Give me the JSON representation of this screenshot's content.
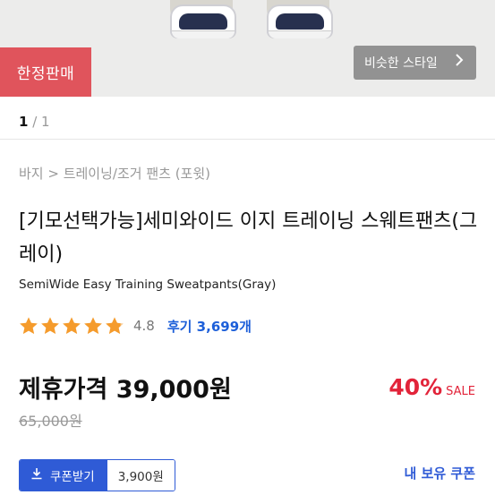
{
  "hero": {
    "limited_badge": "한정판매",
    "similar_style_label": "비슷한 스타일",
    "similar_chevron": "chevron-right-icon"
  },
  "pager": {
    "current": "1",
    "separator": " / ",
    "total": "1"
  },
  "breadcrumb": "바지 > 트레이닝/조거 팬츠 (포윗)",
  "product": {
    "title": "[기모선택가능]세미와이드 이지 트레이닝 스웨트팬츠(그레이)",
    "subtitle": "SemiWide Easy Training Sweatpants(Gray)"
  },
  "rating": {
    "score": "4.8",
    "score_value": 4.8,
    "reviews_label": "후기 3,699개",
    "star_color": "#f59b2c"
  },
  "pricing": {
    "partner_price_label": "제휴가격",
    "partner_price": "39,000원",
    "discount_pct": "40%",
    "sale_label": "SALE",
    "original_price": "65,000원"
  },
  "coupon": {
    "button_label": "쿠폰받기",
    "icon": "download-icon",
    "amount": "3,900원",
    "my_coupons_label": "내 보유 쿠폰"
  },
  "colors": {
    "accent_blue": "#2f5bd6",
    "sale_red": "#e2243a",
    "badge_red": "#e0545c"
  }
}
